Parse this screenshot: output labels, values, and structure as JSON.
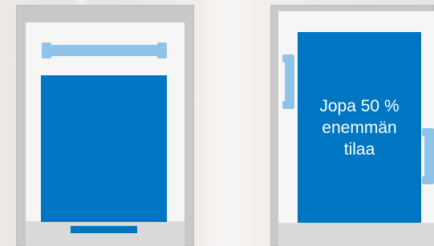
{
  "comparison": {
    "right_cabinet": {
      "message": "Jopa 50 %\nenemmän\ntilaa"
    }
  },
  "colors": {
    "panel_blue": "#0075c2",
    "bar_light_blue": "#8fc4e8",
    "frame_gray": "#c9c9c9",
    "inner_white": "#f6f6f6"
  }
}
